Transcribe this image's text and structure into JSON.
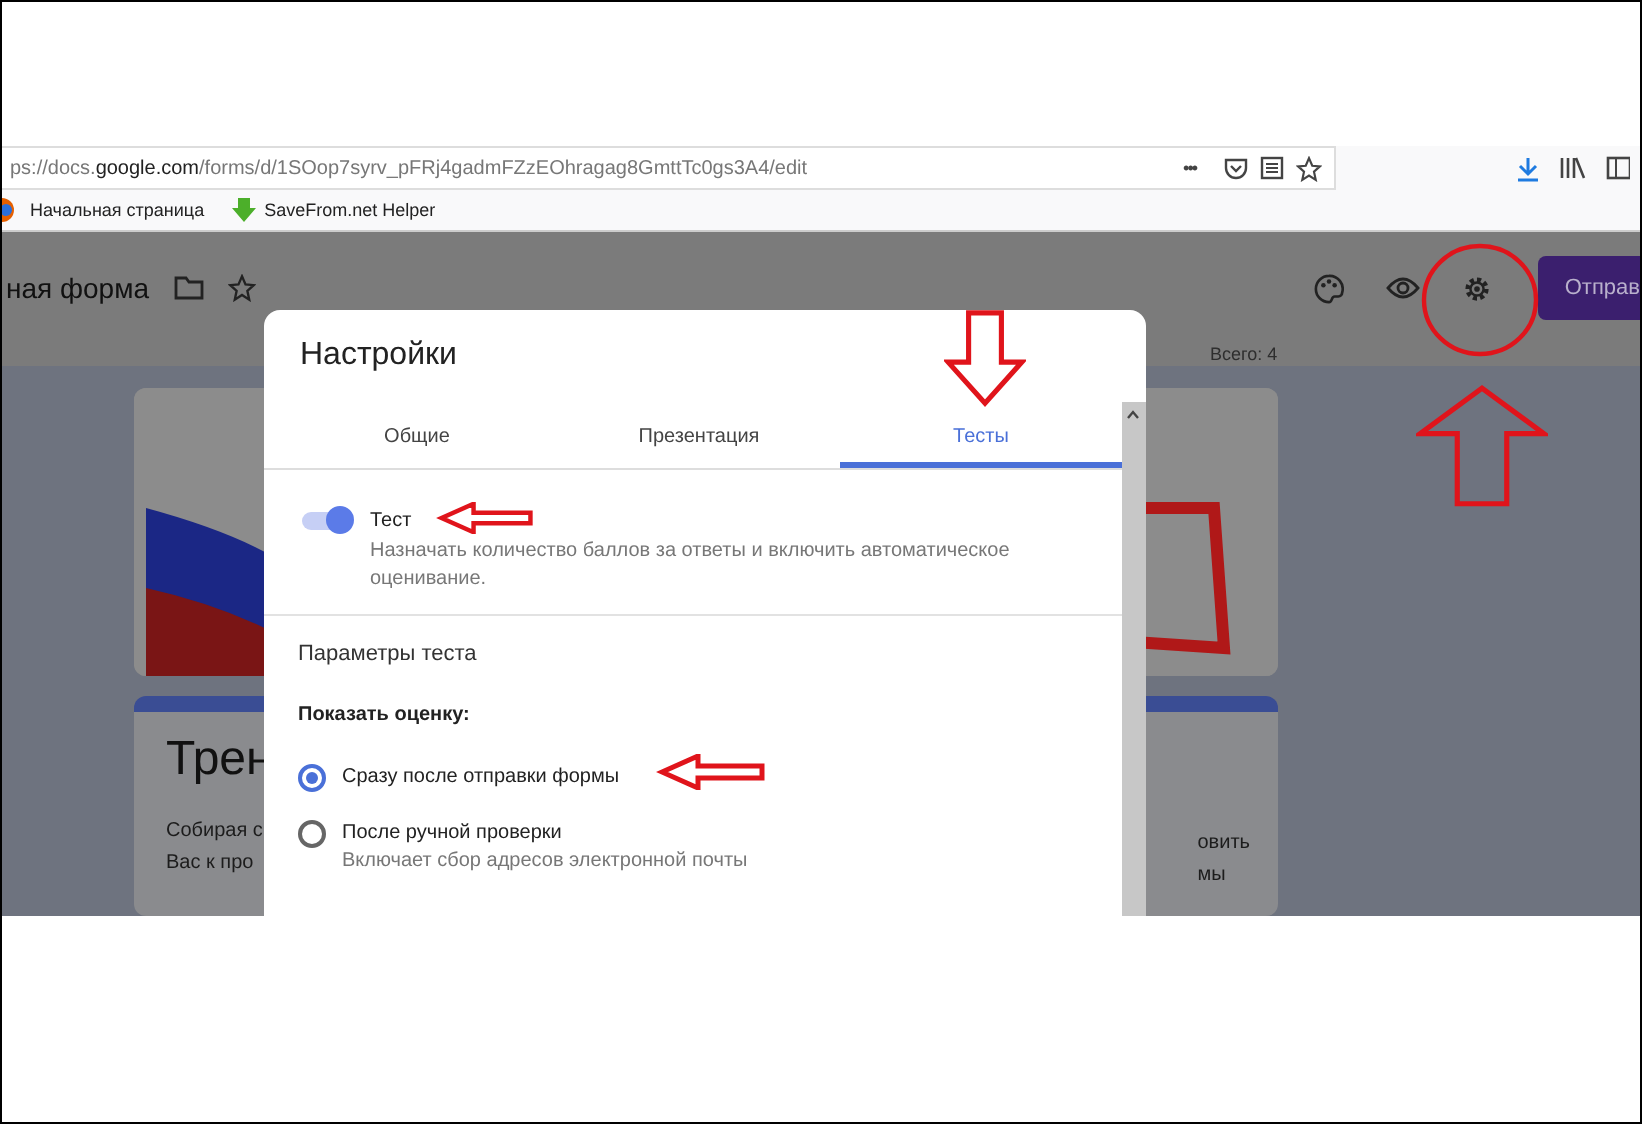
{
  "browser": {
    "url": "ps://docs.**google.com**/forms/d/1SOop7syrv_pFRj4gadmFZzEOhragag8GmttTc0gs3A4/edit",
    "more": "•••",
    "bookmarks": [
      {
        "label": "Начальная страница",
        "kind": "firefox"
      },
      {
        "label": "SaveFrom.net Helper",
        "kind": "savefrom"
      }
    ]
  },
  "form_header": {
    "title": "ная форма",
    "send_button": "Отправ",
    "total": "Всего: 4"
  },
  "form_card": {
    "title": "Трен",
    "left_lines": [
      "Собирая с",
      "Вас к про"
    ],
    "right_lines": [
      "овить",
      "мы"
    ]
  },
  "dialog": {
    "title": "Настройки",
    "tabs": [
      {
        "label": "Общие",
        "selected": false
      },
      {
        "label": "Презентация",
        "selected": false
      },
      {
        "label": "Тесты",
        "selected": true
      }
    ],
    "quiz_toggle": {
      "label": "Тест",
      "description": "Назначать количество баллов за ответы и включить автоматическое оценивание.",
      "on": true
    },
    "section_title": "Параметры теста",
    "show_grade": {
      "label": "Показать оценку:",
      "options": [
        {
          "label": "Сразу после отправки формы",
          "selected": true
        },
        {
          "label": "После ручной проверки",
          "selected": false,
          "hint": "Включает сбор адресов электронной почты"
        }
      ]
    }
  }
}
